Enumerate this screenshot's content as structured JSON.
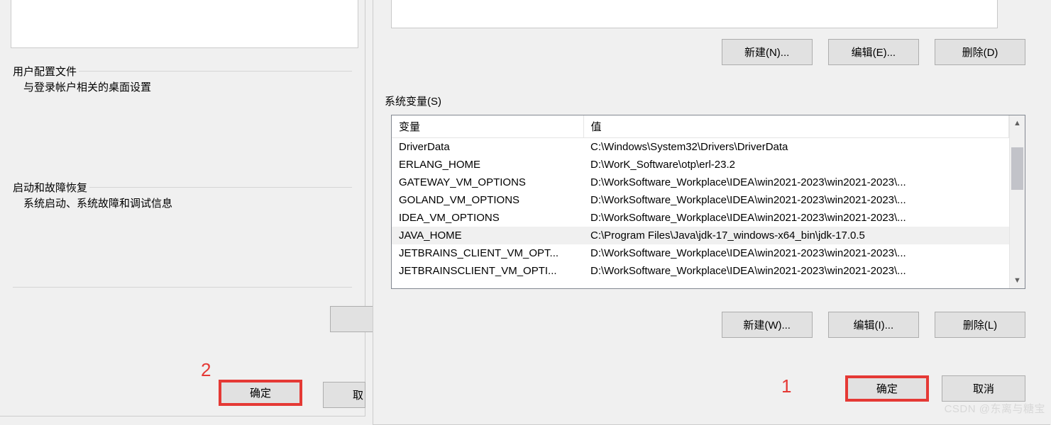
{
  "left": {
    "userProfile": {
      "legend": "用户配置文件",
      "body": "与登录帐户相关的桌面设置"
    },
    "startup": {
      "legend": "启动和故障恢复",
      "body": "系统启动、系统故障和调试信息"
    },
    "ok": "确定",
    "cancelPartial": "取"
  },
  "right": {
    "topButtons": {
      "new": "新建(N)...",
      "edit": "编辑(E)...",
      "del": "删除(D)"
    },
    "sysLabel": "系统变量(S)",
    "headers": {
      "var": "变量",
      "val": "值"
    },
    "rows": [
      {
        "var": "DriverData",
        "val": "C:\\Windows\\System32\\Drivers\\DriverData",
        "sel": false
      },
      {
        "var": "ERLANG_HOME",
        "val": "D:\\WorK_Software\\otp\\erl-23.2",
        "sel": false
      },
      {
        "var": "GATEWAY_VM_OPTIONS",
        "val": "D:\\WorkSoftware_Workplace\\IDEA\\win2021-2023\\win2021-2023\\...",
        "sel": false
      },
      {
        "var": "GOLAND_VM_OPTIONS",
        "val": "D:\\WorkSoftware_Workplace\\IDEA\\win2021-2023\\win2021-2023\\...",
        "sel": false
      },
      {
        "var": "IDEA_VM_OPTIONS",
        "val": "D:\\WorkSoftware_Workplace\\IDEA\\win2021-2023\\win2021-2023\\...",
        "sel": false
      },
      {
        "var": "JAVA_HOME",
        "val": "C:\\Program Files\\Java\\jdk-17_windows-x64_bin\\jdk-17.0.5",
        "sel": true
      },
      {
        "var": "JETBRAINS_CLIENT_VM_OPT...",
        "val": "D:\\WorkSoftware_Workplace\\IDEA\\win2021-2023\\win2021-2023\\...",
        "sel": false
      },
      {
        "var": "JETBRAINSCLIENT_VM_OPTI...",
        "val": "D:\\WorkSoftware_Workplace\\IDEA\\win2021-2023\\win2021-2023\\...",
        "sel": false
      }
    ],
    "bottomButtons": {
      "new": "新建(W)...",
      "edit": "编辑(I)...",
      "del": "删除(L)"
    },
    "ok": "确定",
    "cancel": "取消"
  },
  "annotations": {
    "a1": "1",
    "a2": "2"
  },
  "watermark": "CSDN @东离与糖宝"
}
